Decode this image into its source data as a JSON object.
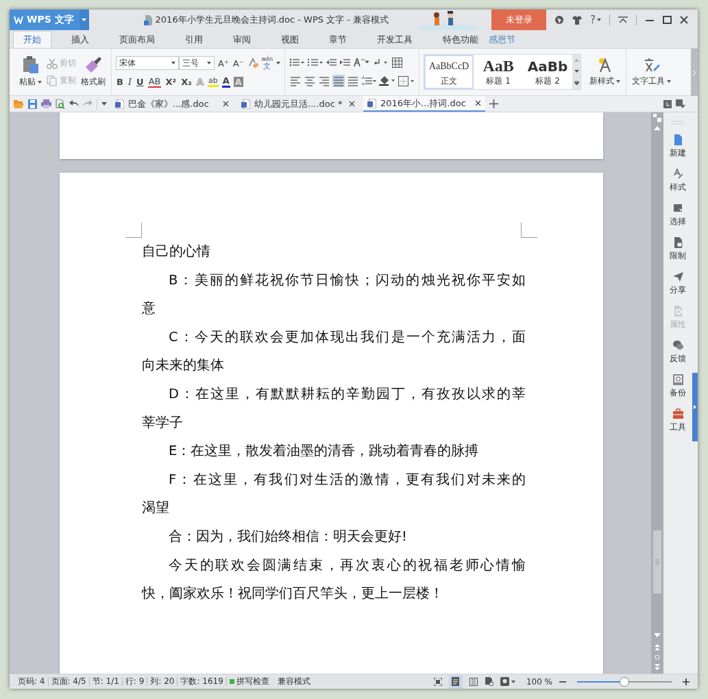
{
  "app_menu": {
    "label": "WPS 文字"
  },
  "title": "2016年小学生元旦晚会主持词.doc - WPS 文字 - 兼容模式",
  "login_button": "未登录",
  "help": "?",
  "ribbon_tabs": [
    {
      "label": "开始",
      "selected": true
    },
    {
      "label": "插入",
      "selected": false
    },
    {
      "label": "页面布局",
      "selected": false
    },
    {
      "label": "引用",
      "selected": false
    },
    {
      "label": "审阅",
      "selected": false
    },
    {
      "label": "视图",
      "selected": false
    },
    {
      "label": "章节",
      "selected": false
    },
    {
      "label": "开发工具",
      "selected": false
    },
    {
      "label": "特色功能",
      "selected": false
    }
  ],
  "festival_label": "感恩节",
  "clipboard": {
    "paste": "粘贴",
    "cut": {
      "label": "剪切",
      "disabled": true
    },
    "copy": {
      "label": "复制",
      "disabled": true
    },
    "format_painter": "格式刷"
  },
  "font": {
    "name": "宋体",
    "size": "三号"
  },
  "size_buttons": [
    "A⁺",
    "A⁻"
  ],
  "phonetic": {
    "top": "wén",
    "main": "文"
  },
  "font_buttons": [
    {
      "glyph": "B",
      "kind": "bold"
    },
    {
      "glyph": "I",
      "kind": "italic"
    },
    {
      "glyph": "U",
      "kind": "underline"
    },
    {
      "glyph": "AB",
      "kind": "strike"
    },
    {
      "glyph": "X²",
      "kind": "plain"
    },
    {
      "glyph": "X₂",
      "kind": "plain"
    }
  ],
  "font_effects": [
    {
      "glyph": "A",
      "kind": "outline"
    },
    {
      "glyph": "ab",
      "kind": "highlight"
    },
    {
      "glyph": "A",
      "kind": "color"
    },
    {
      "glyph": "A",
      "kind": "shading"
    }
  ],
  "align_buttons": [
    {
      "kind": "left",
      "selected": false
    },
    {
      "kind": "center",
      "selected": false
    },
    {
      "kind": "right",
      "selected": false
    },
    {
      "kind": "justify",
      "selected": true
    },
    {
      "kind": "distributed",
      "selected": false
    }
  ],
  "styles": [
    {
      "preview": "AaBbCcD",
      "label": "正文",
      "kind": "normal",
      "selected": true
    },
    {
      "preview": "AaB",
      "label": "标题 1",
      "kind": "h1",
      "selected": false
    },
    {
      "preview": "AaBb",
      "label": "标题 2",
      "kind": "h2",
      "selected": false
    }
  ],
  "new_style": "新样式",
  "text_tools": "文字工具",
  "doc_tabs": [
    {
      "label": "巴金《家》...感.doc",
      "selected": false
    },
    {
      "label": "幼儿园元旦活....doc *",
      "selected": false
    },
    {
      "label": "2016年小...持词.doc",
      "selected": true
    }
  ],
  "paragraphs": [
    {
      "lines": [
        "自己的心情"
      ],
      "indent": false
    },
    {
      "lines": [
        "B：美丽的鲜花祝你节日愉快；闪动的烛光祝你平安如",
        "意"
      ],
      "indent": true
    },
    {
      "lines": [
        "C：今天的联欢会更加体现出我们是一个充满活力，面",
        "向未来的集体"
      ],
      "indent": true
    },
    {
      "lines": [
        "D：在这里，有默默耕耘的辛勤园丁，有孜孜以求的莘",
        "莘学子"
      ],
      "indent": true
    },
    {
      "lines": [
        "E：在这里，散发着油墨的清香，跳动着青春的脉搏"
      ],
      "indent": true
    },
    {
      "lines": [
        "F：在这里，有我们对生活的激情，更有我们对未来的",
        "渴望"
      ],
      "indent": true
    },
    {
      "lines": [
        "合：因为，我们始终相信：明天会更好!"
      ],
      "indent": true
    },
    {
      "lines": [
        "今天的联欢会圆满结束，再次衷心的祝福老师心情愉",
        "快，阖家欢乐！祝同学们百尺竿头，更上一层楼！"
      ],
      "indent": true
    }
  ],
  "sidebar": [
    {
      "label": "新建",
      "kind": "new",
      "disabled": false
    },
    {
      "label": "样式",
      "kind": "style",
      "disabled": false
    },
    {
      "label": "选择",
      "kind": "select",
      "disabled": false
    },
    {
      "label": "限制",
      "kind": "restrict",
      "disabled": false
    },
    {
      "label": "分享",
      "kind": "share",
      "disabled": false
    },
    {
      "label": "属性",
      "kind": "props",
      "disabled": true
    },
    {
      "label": "反馈",
      "kind": "feedback",
      "disabled": false
    },
    {
      "label": "备份",
      "kind": "backup",
      "disabled": false
    },
    {
      "label": "工具",
      "kind": "tools",
      "disabled": false
    }
  ],
  "status_bar": {
    "items": [
      "页码: 4",
      "页面: 4/5",
      "节: 1/1",
      "行: 9",
      "列: 20",
      "字数: 1619"
    ],
    "spell_check": "拼写检查",
    "mode": "兼容模式",
    "zoom": "100 %",
    "zoom_slider": {
      "level": 0.5
    }
  }
}
